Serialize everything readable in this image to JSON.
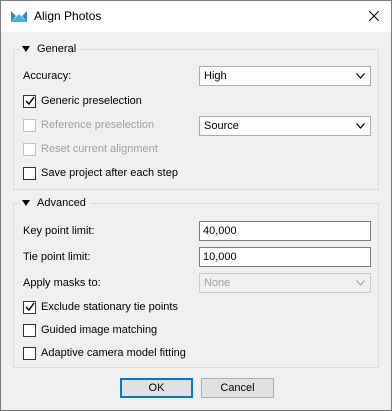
{
  "window": {
    "title": "Align Photos"
  },
  "general": {
    "header": "General",
    "accuracy_label": "Accuracy:",
    "accuracy_value": "High",
    "generic_preselection": {
      "label": "Generic preselection",
      "checked": true
    },
    "reference_preselection": {
      "label": "Reference preselection",
      "checked": false,
      "enabled": false
    },
    "reference_source_value": "Source",
    "reset_alignment": {
      "label": "Reset current alignment",
      "checked": false,
      "enabled": false
    },
    "save_project": {
      "label": "Save project after each step",
      "checked": false
    }
  },
  "advanced": {
    "header": "Advanced",
    "key_point_label": "Key point limit:",
    "key_point_value": "40,000",
    "tie_point_label": "Tie point limit:",
    "tie_point_value": "10,000",
    "apply_masks_label": "Apply masks to:",
    "apply_masks_value": "None",
    "exclude_stationary": {
      "label": "Exclude stationary tie points",
      "checked": true
    },
    "guided_matching": {
      "label": "Guided image matching",
      "checked": false
    },
    "adaptive_fitting": {
      "label": "Adaptive camera model fitting",
      "checked": false
    }
  },
  "buttons": {
    "ok": "OK",
    "cancel": "Cancel"
  },
  "colors": {
    "accent": "#0078d7",
    "disabled_text": "#a0a0a0"
  }
}
